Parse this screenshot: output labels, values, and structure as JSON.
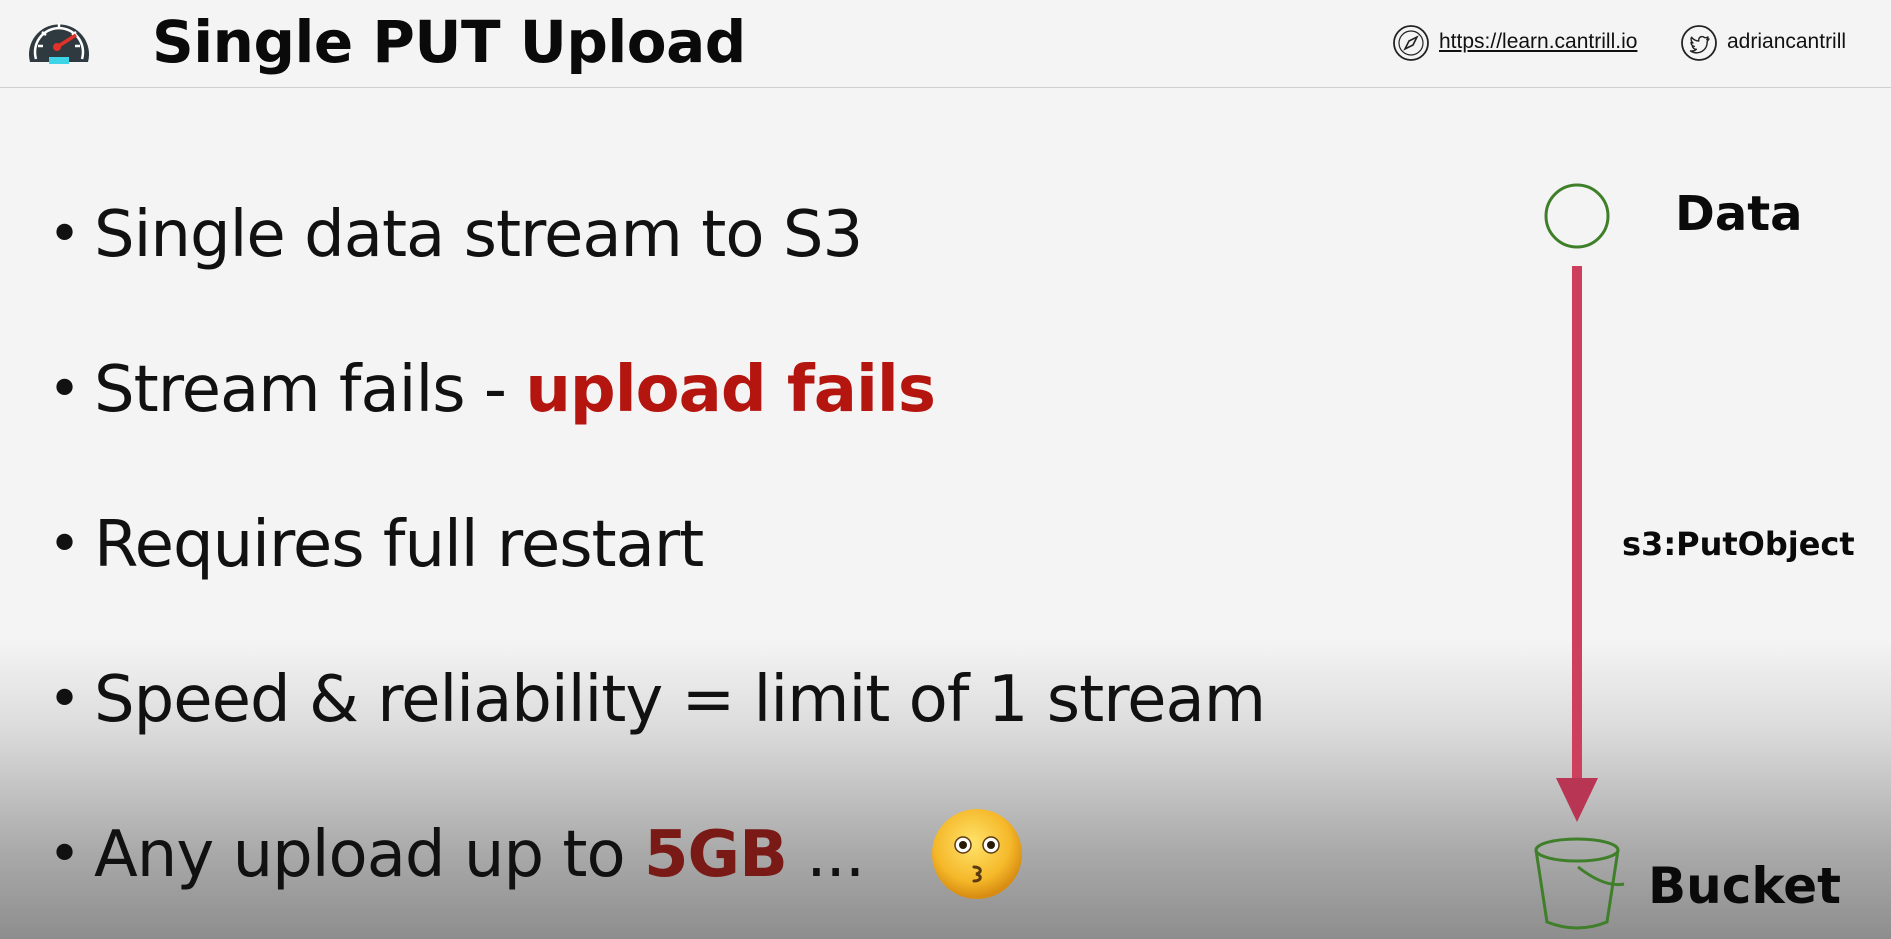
{
  "header": {
    "title": "Single PUT Upload",
    "website": "https://learn.cantrill.io",
    "twitter_handle": "adriancantrill",
    "icons": {
      "logo": "speedometer-icon",
      "website": "compass-icon",
      "twitter": "twitter-bird-icon"
    }
  },
  "bullets": [
    {
      "bullet": "•",
      "text": "Single data stream to S3"
    },
    {
      "bullet": "•",
      "text": "Stream fails - ",
      "highlight": "upload fails"
    },
    {
      "bullet": "•",
      "text": "Requires full restart"
    },
    {
      "bullet": "•",
      "text": "Speed & reliability = limit of 1 stream"
    },
    {
      "bullet": "•",
      "text": "Any upload up to ",
      "highlight": "5GB",
      "suffix": " ..."
    }
  ],
  "emoji": "flushed-kissing-face-emoji",
  "diagram": {
    "source_label": "Data",
    "arrow_label": "s3:PutObject",
    "target_label": "Bucket",
    "icons": {
      "source": "data-circle-icon",
      "target": "bucket-icon"
    }
  },
  "colors": {
    "accent_red": "#b5150f",
    "accent_dark_red": "#7a1a16",
    "arrow": "#cc3f5d",
    "diagram_green": "#3f7f2a"
  }
}
